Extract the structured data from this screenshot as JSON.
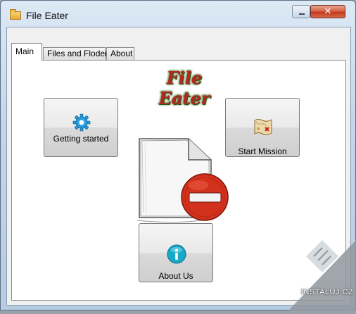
{
  "window": {
    "title": "File Eater",
    "close_glyph": "✕"
  },
  "tabs": [
    {
      "label": "Main"
    },
    {
      "label": "Files and Floders"
    },
    {
      "label": "About"
    }
  ],
  "main": {
    "logo_text": "File Eater",
    "buttons": {
      "getting_started": {
        "label": "Getting started",
        "icon": "gear-icon"
      },
      "start_mission": {
        "label": "Start Mission",
        "icon": "treasure-map-icon"
      },
      "about_us": {
        "label": "About Us",
        "icon": "info-icon"
      }
    }
  },
  "watermark": {
    "text": "INSTALUJ.CZ"
  },
  "colors": {
    "logo_red": "#b9241f",
    "logo_glow": "#2d6b1d",
    "close_red": "#c0391d",
    "gear_blue": "#2a9fe0",
    "info_teal": "#17a8c8"
  }
}
